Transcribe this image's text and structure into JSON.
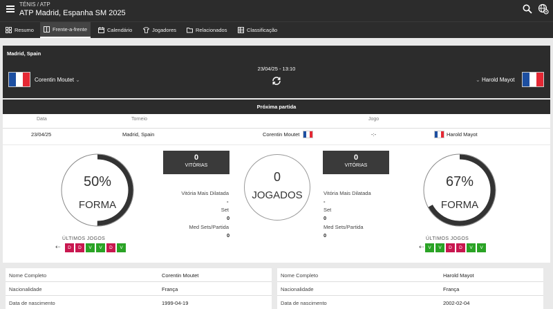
{
  "header": {
    "breadcrumb": "TÉNIS / ATP",
    "title": "ATP Madrid, Espanha SM 2025",
    "icons": [
      "menu-icon",
      "search-icon",
      "globe-settings-icon"
    ]
  },
  "tabs": [
    {
      "label": "Resumo",
      "icon": "grid-icon"
    },
    {
      "label": "Frente-a-frente",
      "icon": "versus-icon",
      "active": true
    },
    {
      "label": "Calendário",
      "icon": "calendar-icon"
    },
    {
      "label": "Jogadores",
      "icon": "shirt-icon"
    },
    {
      "label": "Relacionados",
      "icon": "folder-icon"
    },
    {
      "label": "Classificação",
      "icon": "table-icon"
    }
  ],
  "match": {
    "location": "Madrid, Spain",
    "datetime": "23/04/25 - 13:10",
    "player_left": "Corentin Moutet",
    "player_right": "Harold Mayot",
    "flag_colors": [
      "#1d4fa1",
      "#ffffff",
      "#e52834"
    ]
  },
  "next_match": {
    "title": "Próxima partida",
    "headers": {
      "date": "Data",
      "tournament": "Torneio",
      "game": "Jogo"
    },
    "row": {
      "date": "23/04/25",
      "tournament": "Madrid, Spain",
      "home": "Corentin Moutet",
      "score": "-:-",
      "away": "Harold Mayot"
    }
  },
  "stats": {
    "left": {
      "form_pct": "50%",
      "form_value": 0.5,
      "form_label": "FORMA",
      "wins": "0",
      "wins_label": "VITÓRIAS",
      "last_label": "ÚLTIMOS JOGOS",
      "last_games": [
        "D",
        "D",
        "V",
        "V",
        "D",
        "V"
      ]
    },
    "right": {
      "form_pct": "67%",
      "form_value": 0.67,
      "form_label": "FORMA",
      "wins": "0",
      "wins_label": "VITÓRIAS",
      "last_label": "ÚLTIMOS JOGOS",
      "last_games": [
        "V",
        "V",
        "D",
        "D",
        "V",
        "V"
      ]
    },
    "played": "0",
    "played_label": "JOGADOS",
    "rows": [
      {
        "label": "Vitória Mais Dilatada",
        "left": "-",
        "right": "-"
      },
      {
        "label": "Set",
        "left": "0",
        "right": "0"
      },
      {
        "label": "Med Sets/Partida",
        "left": "0",
        "right": "0"
      }
    ],
    "colors": {
      "loss": "#c8174f",
      "win": "#2aa325",
      "ring": "#333333"
    }
  },
  "info_left": [
    {
      "key": "Nome Completo",
      "value": "Corentin Moutet"
    },
    {
      "key": "Nacionalidade",
      "value": "França"
    },
    {
      "key": "Data de nascimento",
      "value": "1999-04-19"
    }
  ],
  "info_right": [
    {
      "key": "Nome Completo",
      "value": "Harold Mayot"
    },
    {
      "key": "Nacionalidade",
      "value": "França"
    },
    {
      "key": "Data de nascimento",
      "value": "2002-02-04"
    }
  ]
}
